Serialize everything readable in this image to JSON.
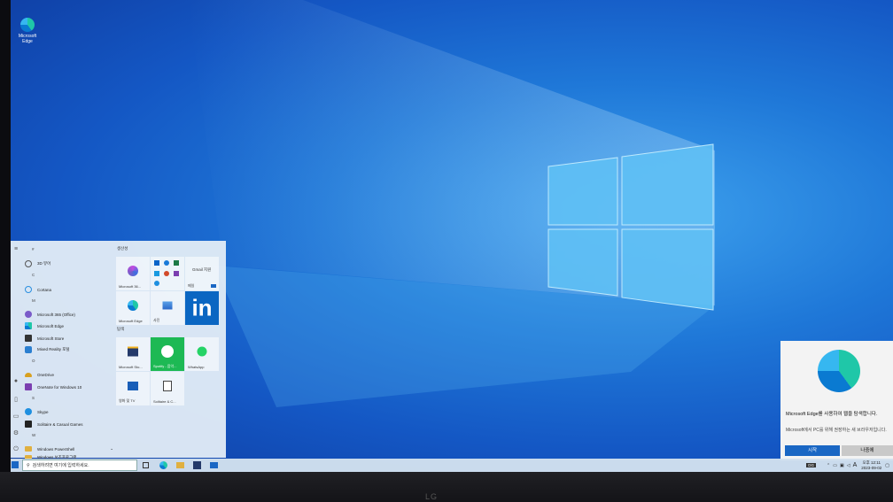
{
  "desktop": {
    "icons": [
      {
        "label": "Microsoft Edge",
        "icon": "edge-icon"
      }
    ]
  },
  "start_menu": {
    "letters": {
      "hash": "#",
      "c": "C",
      "m": "M",
      "o": "O",
      "s": "S",
      "w": "W"
    },
    "apps": [
      {
        "label": "3D 뷰어",
        "icon": "cube-icon",
        "color": "#555555"
      },
      {
        "label": "Cortana",
        "icon": "cortana-icon",
        "color": "#2a8fe0"
      },
      {
        "label": "Microsoft 365 (Office)",
        "icon": "office-icon",
        "color": "#7a5bc9"
      },
      {
        "label": "Microsoft Edge",
        "icon": "edge-icon",
        "color": "#1f9ad8"
      },
      {
        "label": "Microsoft Store",
        "icon": "store-icon",
        "color": "#333333"
      },
      {
        "label": "Mixed Reality 포털",
        "icon": "mixed-reality-icon",
        "color": "#2b7fd0"
      },
      {
        "label": "OneDrive",
        "icon": "onedrive-icon",
        "color": "#d8a020"
      },
      {
        "label": "OneNote for Windows 10",
        "icon": "onenote-icon",
        "color": "#7b3fb0"
      },
      {
        "label": "Skype",
        "icon": "skype-icon",
        "color": "#1e8fe0"
      },
      {
        "label": "Solitaire & Casual Games",
        "icon": "cards-icon",
        "color": "#222222"
      },
      {
        "label": "Windows PowerShell",
        "icon": "folder-icon",
        "color": "#e0b040"
      },
      {
        "label": "Windows 보조프로그램",
        "icon": "folder-icon",
        "color": "#e0b040"
      }
    ],
    "groups": {
      "productivity": "생산성",
      "explore": "탐색"
    },
    "tiles": {
      "ms365": "Microsoft 36...",
      "mail": "Gmail 지원",
      "mail_small": "메일",
      "edge": "Microsoft Edge",
      "photos": "사진",
      "linkedin": "in",
      "store": "Microsoft Sto...",
      "spotify": "Spotify - 음악...",
      "whatsapp": "WhatsApp",
      "movies": "영화 및 TV",
      "solitaire": "Solitaire & C..."
    }
  },
  "taskbar": {
    "search_placeholder": "검색하려면 여기에 입력하세요.",
    "tray_lang": "A",
    "time": "오후 12:11",
    "date": "2023-09-02",
    "tray_app": "DG"
  },
  "toast": {
    "title": "Microsoft Edge를 사용하여 웹을 탐색합니다.",
    "body": "Microsoft에서 PC를 위해 권장하는 새 브라우저입니다.",
    "primary_button": "시작",
    "secondary_button": "나중에"
  },
  "monitor": {
    "brand": "LG"
  },
  "colors": {
    "accent": "#1a67c4",
    "spotify": "#1db954",
    "linkedin": "#0a66c2"
  }
}
